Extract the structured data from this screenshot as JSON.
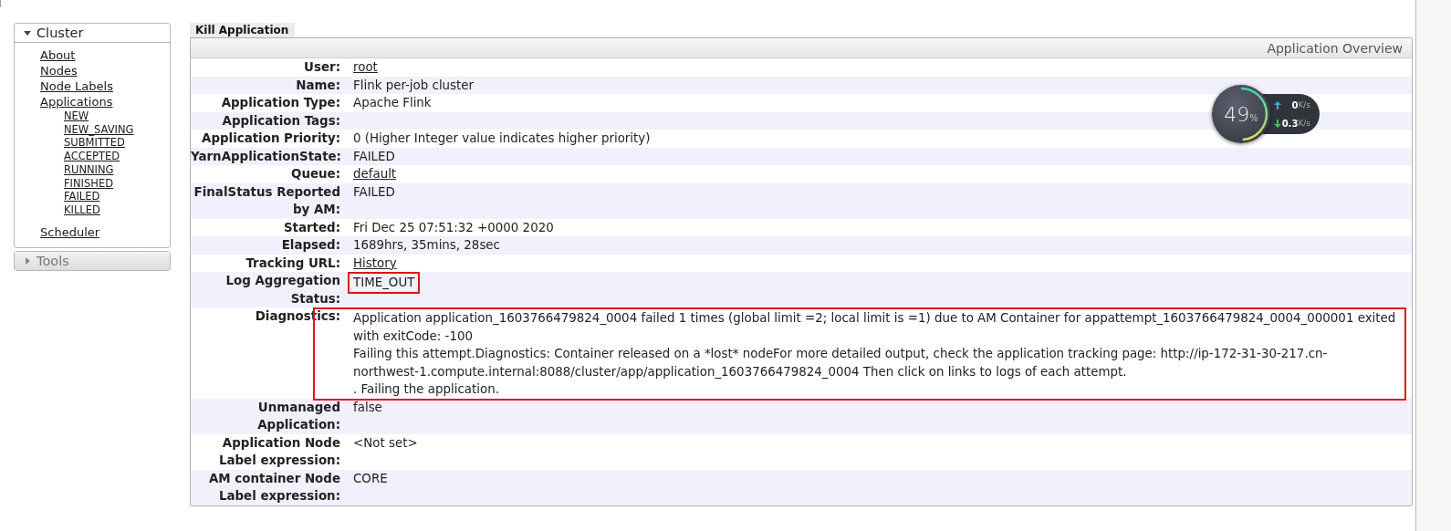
{
  "sidebar": {
    "sections": [
      {
        "title": "Cluster",
        "expanded": true,
        "items": [
          {
            "label": "About"
          },
          {
            "label": "Nodes"
          },
          {
            "label": "Node Labels"
          },
          {
            "label": "Applications",
            "children": [
              {
                "label": "NEW"
              },
              {
                "label": "NEW_SAVING"
              },
              {
                "label": "SUBMITTED"
              },
              {
                "label": "ACCEPTED"
              },
              {
                "label": "RUNNING"
              },
              {
                "label": "FINISHED"
              },
              {
                "label": "FAILED"
              },
              {
                "label": "KILLED"
              }
            ]
          },
          {
            "label": "Scheduler"
          }
        ]
      },
      {
        "title": "Tools",
        "expanded": false
      }
    ]
  },
  "kill_button": "Kill Application",
  "overview": {
    "title": "Application Overview",
    "rows": [
      {
        "label": "User:",
        "kind": "link",
        "lines": [
          "root"
        ]
      },
      {
        "label": "Name:",
        "kind": "text",
        "lines": [
          "Flink per-job cluster"
        ]
      },
      {
        "label": "Application Type:",
        "kind": "text",
        "lines": [
          "Apache Flink"
        ]
      },
      {
        "label": "Application Tags:"
      },
      {
        "label": "Application Priority:",
        "kind": "text",
        "lines": [
          "0 (Higher Integer value indicates higher priority)"
        ]
      },
      {
        "label": "YarnApplicationState:",
        "kind": "text",
        "lines": [
          "FAILED"
        ]
      },
      {
        "label": "Queue:",
        "kind": "link",
        "lines": [
          "default"
        ]
      },
      {
        "label": "FinalStatus Reported by AM:",
        "kind": "text",
        "lines": [
          "FAILED"
        ]
      },
      {
        "label": "Started:",
        "kind": "text",
        "lines": [
          "Fri Dec 25 07:51:32 +0000 2020"
        ]
      },
      {
        "label": "Elapsed:",
        "kind": "text",
        "lines": [
          "1689hrs, 35mins, 28sec"
        ]
      },
      {
        "label": "Tracking URL:",
        "kind": "link",
        "lines": [
          "History"
        ]
      },
      {
        "label": "Log Aggregation Status:",
        "kind": "text",
        "lines": [
          "TIME_OUT"
        ],
        "highlighted": true
      },
      {
        "label": "Diagnostics:",
        "kind": "text",
        "lines": [
          "Application application_1603766479824_0004 failed 1 times (global limit =2; local limit is =1) due to AM Container for appattempt_1603766479824_0004_000001 exited",
          "with exitCode: -100",
          "Failing this attempt.Diagnostics: Container released on a *lost* nodeFor more detailed output, check the application tracking page: http://ip-172-31-30-217.cn-",
          "northwest-1.compute.internal:8088/cluster/app/application_1603766479824_0004 Then click on links to logs of each attempt.",
          ". Failing the application."
        ],
        "highlighted": true
      },
      {
        "label": "Unmanaged Application:",
        "kind": "text",
        "lines": [
          "false"
        ]
      },
      {
        "label": "Application Node Label expression:",
        "kind": "text",
        "lines": [
          "<Not set>"
        ]
      },
      {
        "label": "AM container Node Label expression:",
        "kind": "text",
        "lines": [
          "CORE"
        ]
      }
    ]
  },
  "speed_widget": {
    "percent": "49",
    "unit": "%",
    "level": 0.49,
    "upload": "0",
    "upload_unit": "K/s",
    "download": "0.3",
    "download_unit": "K/s"
  }
}
